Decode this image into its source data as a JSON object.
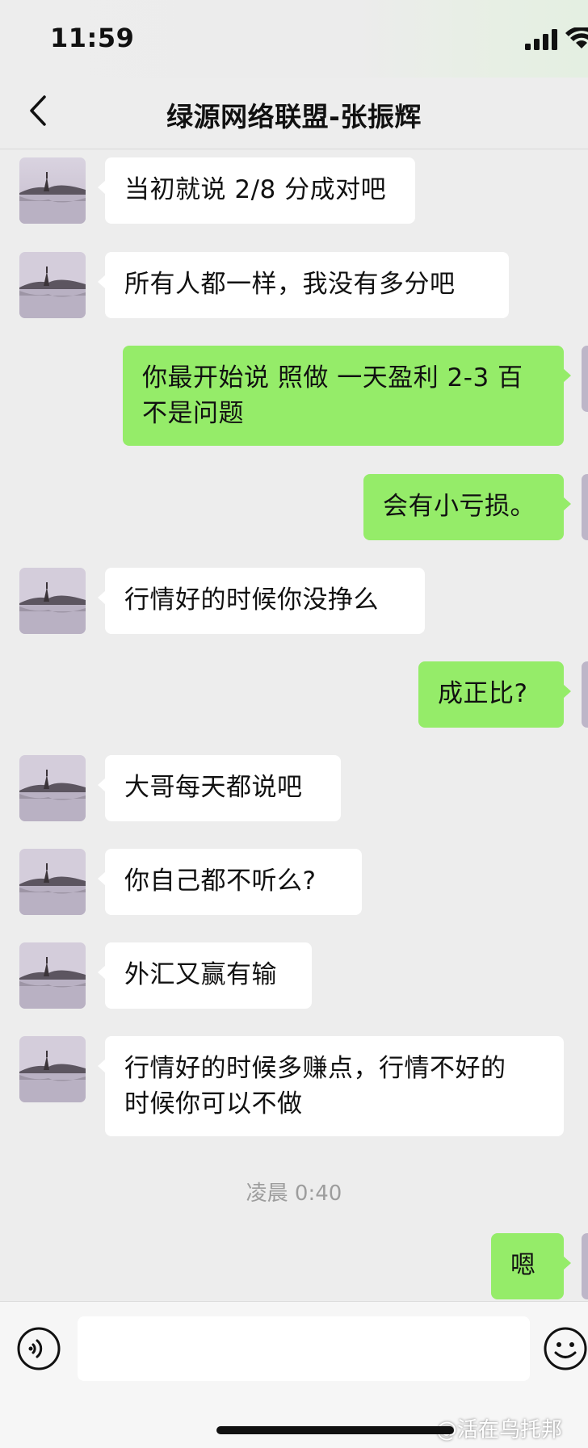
{
  "status_bar": {
    "time": "11:59",
    "icons": [
      "signal-icon",
      "wifi-icon"
    ]
  },
  "nav": {
    "title": "绿源网络联盟-张振辉",
    "back_icon": "chevron-left-icon"
  },
  "messages": [
    {
      "side": "in",
      "text": "当初就说 2/8 分成对吧"
    },
    {
      "side": "in",
      "text": "所有人都一样，我没有多分吧"
    },
    {
      "side": "out",
      "text": "你最开始说 照做 一天盈利 2-3 百\n不是问题"
    },
    {
      "side": "out",
      "text": "会有小亏损。"
    },
    {
      "side": "in",
      "text": "行情好的时候你没挣么"
    },
    {
      "side": "out",
      "text": "成正比?"
    },
    {
      "side": "in",
      "text": "大哥每天都说吧"
    },
    {
      "side": "in",
      "text": "你自己都不听么?"
    },
    {
      "side": "in",
      "text": "外汇又赢有输"
    },
    {
      "side": "in",
      "text": "行情好的时候多赚点，行情不好的\n时候你可以不做"
    },
    {
      "side": "out",
      "text": "嗯"
    }
  ],
  "timestamp": "凌晨 0:40",
  "input_bar": {
    "voice_icon": "voice-icon",
    "emoji_icon": "emoji-icon",
    "input_value": ""
  },
  "watermark": "@活在乌托邦",
  "colors": {
    "background": "#ededed",
    "incoming_bubble": "#ffffff",
    "outgoing_bubble": "#95ec69",
    "timestamp_text": "#9d9d9d"
  }
}
